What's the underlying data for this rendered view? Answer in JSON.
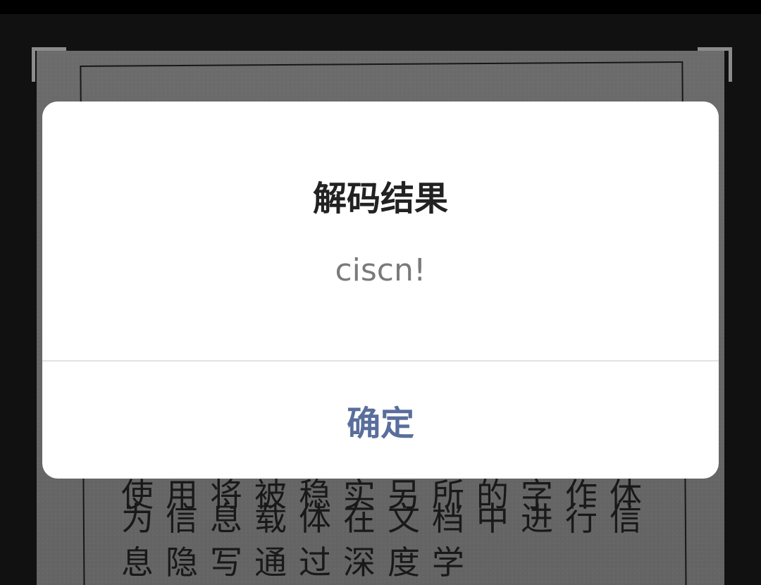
{
  "background_document": {
    "lines": [
      "使用将被稳实另所的字作体",
      "为信息载体在文档中进行信",
      "息隐写通过深度学"
    ]
  },
  "dialog": {
    "title": "解码结果",
    "message": "ciscn!",
    "confirm_label": "确定"
  },
  "colors": {
    "dialog_background": "#ffffff",
    "title_text": "#222222",
    "message_text": "#7a7a7a",
    "confirm_text": "#5a6e9c",
    "scrim": "rgba(0,0,0,0.45)"
  }
}
